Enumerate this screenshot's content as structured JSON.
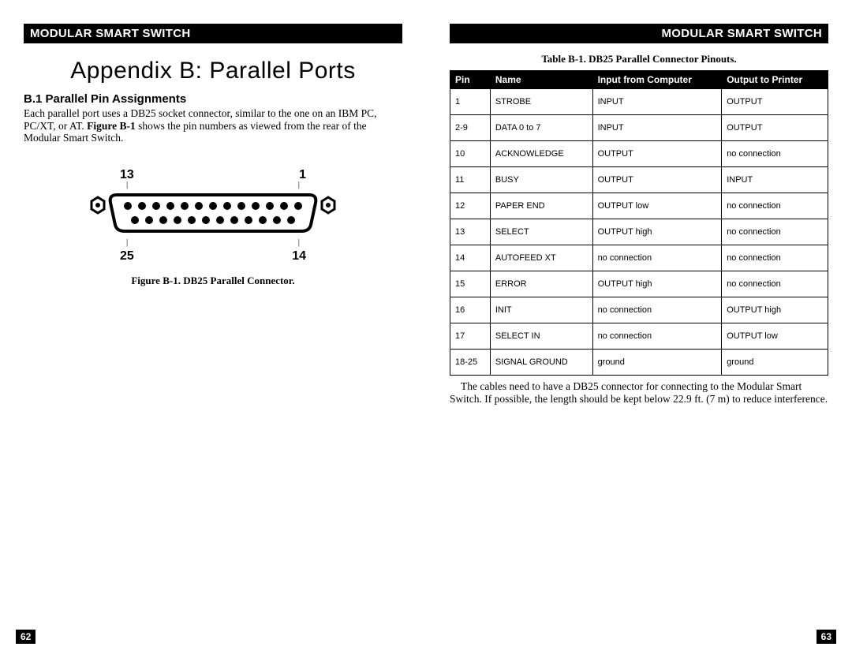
{
  "header": "MODULAR SMART SWITCH",
  "left_page": {
    "title": "Appendix B:  Parallel Ports",
    "section_heading": "B.1  Parallel Pin Assignments",
    "paragraph_pre": "Each parallel port uses a DB25 socket connector, similar to the one on an IBM PC, PC/XT, or AT.  ",
    "paragraph_bold": "Figure B-1",
    "paragraph_post": " shows the pin numbers as viewed from the rear of the Modular Smart Switch.",
    "pin_labels": {
      "tl": "13",
      "tr": "1",
      "bl": "25",
      "br": "14"
    },
    "figure_caption": "Figure B-1.  DB25 Parallel Connector.",
    "page_num": "62"
  },
  "right_page": {
    "table_caption": "Table B-1.  DB25 Parallel Connector Pinouts.",
    "columns": [
      "Pin",
      "Name",
      "Input from Computer",
      "Output to Printer"
    ],
    "rows": [
      [
        "1",
        "STROBE",
        "INPUT",
        "OUTPUT"
      ],
      [
        "2-9",
        "DATA 0 to 7",
        "INPUT",
        "OUTPUT"
      ],
      [
        "10",
        "ACKNOWLEDGE",
        "OUTPUT",
        "no connection"
      ],
      [
        "11",
        "BUSY",
        "OUTPUT",
        "INPUT"
      ],
      [
        "12",
        "PAPER END",
        "OUTPUT low",
        "no connection"
      ],
      [
        "13",
        "SELECT",
        "OUTPUT high",
        "no connection"
      ],
      [
        "14",
        "AUTOFEED XT",
        "no connection",
        "no connection"
      ],
      [
        "15",
        "ERROR",
        "OUTPUT high",
        "no connection"
      ],
      [
        "16",
        "INIT",
        "no connection",
        "OUTPUT high"
      ],
      [
        "17",
        "SELECT IN",
        "no connection",
        "OUTPUT low"
      ],
      [
        "18-25",
        "SIGNAL GROUND",
        "ground",
        "ground"
      ]
    ],
    "note": "The cables need to have a DB25 connector for connecting to the Modular Smart Switch.  If possible, the length should be kept below 22.9 ft. (7 m) to reduce interference.",
    "page_num": "63"
  }
}
